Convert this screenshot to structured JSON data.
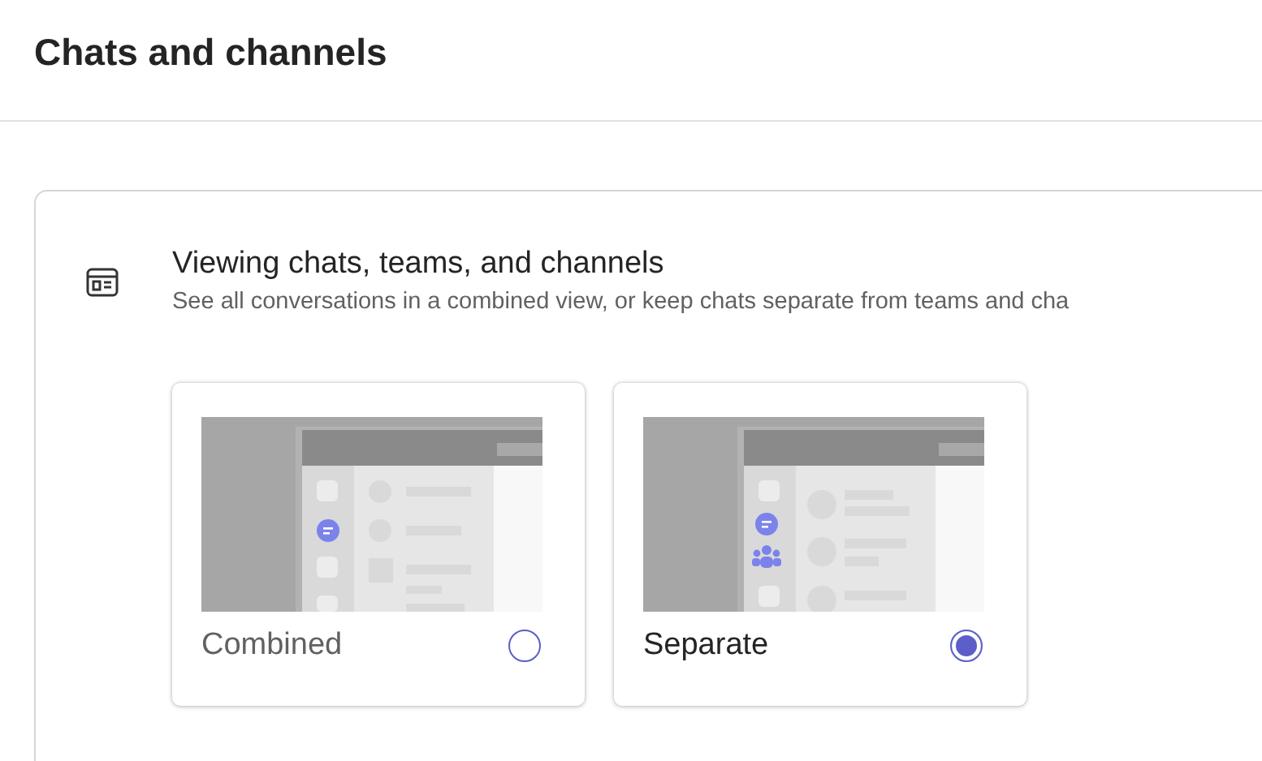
{
  "page": {
    "title": "Chats and channels"
  },
  "section": {
    "title": "Viewing chats, teams, and channels",
    "description": "See all conversations in a combined view, or keep chats separate from teams and cha"
  },
  "options": [
    {
      "label": "Combined",
      "kind": "combined",
      "selected": false
    },
    {
      "label": "Separate",
      "kind": "separate",
      "selected": true
    }
  ]
}
